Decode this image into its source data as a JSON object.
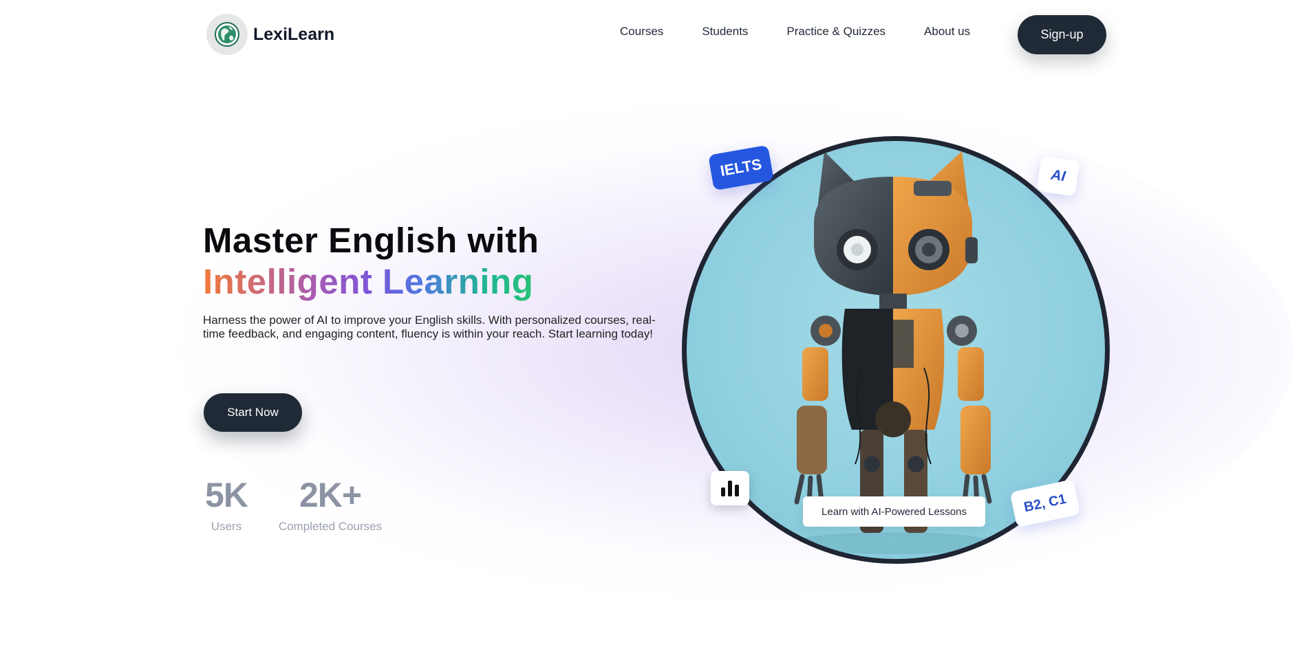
{
  "brand": {
    "name": "LexiLearn",
    "logo_icon": "globe-icon"
  },
  "nav": {
    "links": [
      {
        "label": "Courses"
      },
      {
        "label": "Students"
      },
      {
        "label": "Practice & Quizzes"
      },
      {
        "label": "About us"
      }
    ],
    "signup_label": "Sign-up"
  },
  "hero": {
    "headline_line1": "Master English with",
    "headline_line2": "Intelligent Learning",
    "lead": "Harness the power of AI to improve your English skills. With personalized courses, real-time feedback, and engaging content, fluency is within your reach. Start learning today!",
    "cta_label": "Start Now",
    "stats": [
      {
        "value": "5K",
        "label": "Users"
      },
      {
        "value": "2K+",
        "label": "Completed Courses"
      }
    ],
    "image_subject": "robot-cat-illustration",
    "badges": {
      "ielts": "IELTS",
      "ai": "AI",
      "level": "B2, C1"
    },
    "chart_icon": "bar-chart-icon",
    "caption": "Learn with AI-Powered Lessons"
  },
  "colors": {
    "primary_dark": "#1f2a36",
    "accent_blue": "#2456e0",
    "gradient_start": "#f2793a",
    "gradient_mid": "#7c55d9",
    "gradient_end": "#2bc275",
    "stat_gray": "#8c94a3",
    "image_bg": "#8fcfdf"
  }
}
